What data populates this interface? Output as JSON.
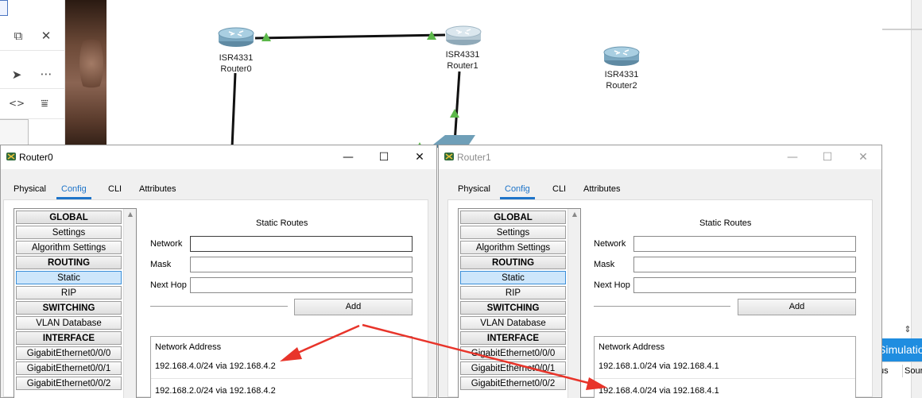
{
  "topology": {
    "router0": {
      "model": "ISR4331",
      "name": "Router0"
    },
    "router1": {
      "model": "ISR4331",
      "name": "Router1"
    },
    "router2": {
      "model": "ISR4331",
      "name": "Router2"
    }
  },
  "colors": {
    "link": "#111111",
    "link_status": "#5cb84a",
    "accent": "#1e74c9",
    "annotation_arrow": "#e8342a",
    "simulation_button": "#1f8de0"
  },
  "tabs": [
    "Physical",
    "Config",
    "CLI",
    "Attributes"
  ],
  "nav_items": [
    {
      "label": "GLOBAL",
      "type": "header"
    },
    {
      "label": "Settings",
      "type": "item"
    },
    {
      "label": "Algorithm Settings",
      "type": "item"
    },
    {
      "label": "ROUTING",
      "type": "header"
    },
    {
      "label": "Static",
      "type": "item",
      "selected": true
    },
    {
      "label": "RIP",
      "type": "item"
    },
    {
      "label": "SWITCHING",
      "type": "header"
    },
    {
      "label": "VLAN Database",
      "type": "item"
    },
    {
      "label": "INTERFACE",
      "type": "header"
    },
    {
      "label": "GigabitEthernet0/0/0",
      "type": "item"
    },
    {
      "label": "GigabitEthernet0/0/1",
      "type": "item"
    },
    {
      "label": "GigabitEthernet0/0/2",
      "type": "item"
    }
  ],
  "static_routes": {
    "title": "Static Routes",
    "network_label": "Network",
    "mask_label": "Mask",
    "next_hop_label": "Next Hop",
    "add_label": "Add",
    "list_header": "Network Address"
  },
  "windows": [
    {
      "title": "Router0",
      "routes": [
        "192.168.4.0/24 via 192.168.4.2",
        "192.168.2.0/24 via 192.168.4.2"
      ]
    },
    {
      "title": "Router1",
      "routes": [
        "192.168.1.0/24 via 192.168.4.1",
        "192.168.4.0/24 via 192.168.4.1"
      ]
    }
  ],
  "window_controls": {
    "minimize": "—",
    "maximize": "☐",
    "close": "✕"
  },
  "right_panel": {
    "simulation_label": "Simulation",
    "tab_status_partial": "tus",
    "tab_source_partial": "Sour"
  }
}
